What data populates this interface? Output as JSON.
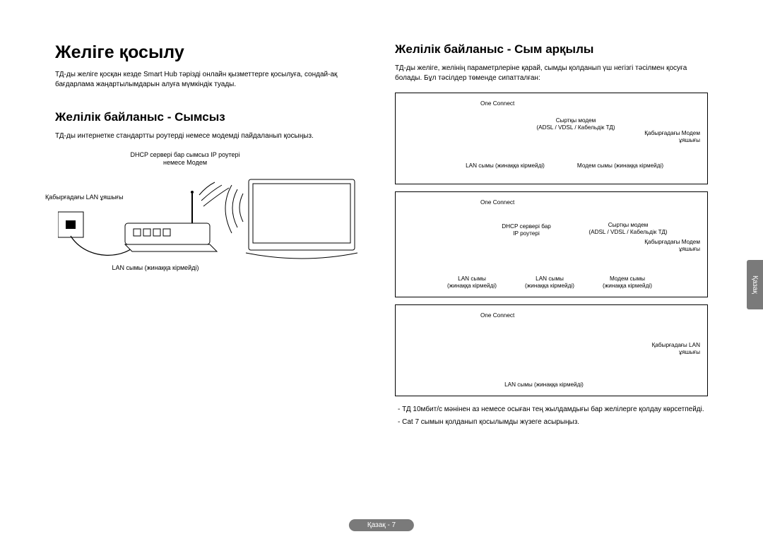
{
  "left": {
    "h1": "Желіге қосылу",
    "intro": "ТД-ды желіге қосқан кезде Smart Hub тәрізді онлайн қызметтерге қосылуға, сондай-ақ бағдарлама жаңартылымдарын алуға мүмкіндік туады.",
    "h2": "Желілік байланыс - Сымсыз",
    "sub": "ТД-ды интернетке стандартты роутерді немесе модемді пайдаланып қосыңыз.",
    "labels": {
      "router": "DHCP сервері бар сымсыз IP роутері немесе Модем",
      "wall": "Қабырғадағы LAN ұяшығы",
      "lan_cable": "LAN сымы (жинаққа кірмейді)"
    }
  },
  "right": {
    "h2": "Желілік байланыс - Сым арқылы",
    "sub": "ТД-ды желіге, желінің параметрлеріне қарай, сымды қолданып үш негізгі тәсілмен қосуға болады. Бұл тәсілдер төменде сипатталған:",
    "box1": {
      "oc": "One Connect",
      "modem_title": "Сыртқы модем",
      "modem_sub": "(ADSL / VDSL / Кабельдік ТД)",
      "wall": "Қабырғадағы Модем ұяшығы",
      "lan": "LAN сымы (жинаққа кірмейді)",
      "modemcable": "Модем сымы (жинаққа кірмейді)"
    },
    "box2": {
      "oc": "One Connect",
      "iprouter_title": "DHCP сервері бар",
      "iprouter_sub": "IP роутері",
      "modem_title": "Сыртқы модем",
      "modem_sub": "(ADSL / VDSL / Кабельдік ТД)",
      "wall": "Қабырғадағы Модем ұяшығы",
      "lan1": "LAN сымы",
      "lan1b": "(жинаққа кірмейді)",
      "lan2": "LAN сымы",
      "lan2b": "(жинаққа кірмейді)",
      "modemcable": "Модем сымы",
      "modemcableb": "(жинаққа кірмейді)"
    },
    "box3": {
      "oc": "One Connect",
      "wall": "Қабырғадағы LAN ұяшығы",
      "lan": "LAN сымы (жинаққа кірмейді)"
    },
    "notes": [
      "-  ТД 10мбит/с мәнінен аз немесе осыған тең жылдамдығы бар желілерге қолдау көрсетпейді.",
      "-  Cat 7 сымын қолданып қосылымды жүзеге асырыңыз."
    ]
  },
  "side_tab": "Қазақ",
  "footer": "Қазақ - 7"
}
